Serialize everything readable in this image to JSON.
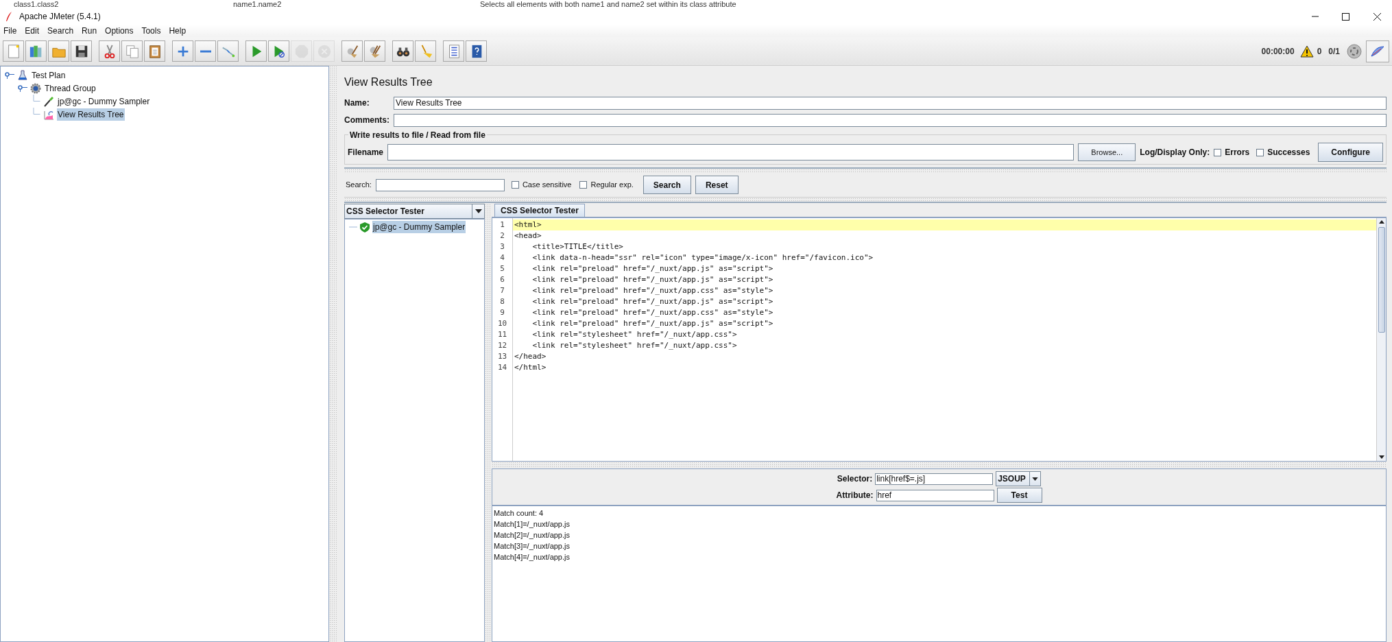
{
  "background_strip": [
    "class1.class2",
    "name1.name2",
    "Selects all elements with both name1 and name2 set within its class attribute"
  ],
  "window": {
    "title": "Apache JMeter (5.4.1)"
  },
  "menu": [
    "File",
    "Edit",
    "Search",
    "Run",
    "Options",
    "Tools",
    "Help"
  ],
  "toolbar": [
    [
      {
        "kind": "new",
        "disabled": false
      },
      {
        "kind": "templates",
        "disabled": false
      },
      {
        "kind": "open",
        "disabled": false
      },
      {
        "kind": "save",
        "disabled": false
      }
    ],
    [
      {
        "kind": "cut",
        "disabled": false
      },
      {
        "kind": "copy",
        "disabled": false
      },
      {
        "kind": "paste",
        "disabled": false
      }
    ],
    [
      {
        "kind": "add",
        "disabled": false
      },
      {
        "kind": "remove",
        "disabled": false
      },
      {
        "kind": "toggle",
        "disabled": false
      }
    ],
    [
      {
        "kind": "start",
        "disabled": false
      },
      {
        "kind": "start_no_timers",
        "disabled": false
      },
      {
        "kind": "stop",
        "disabled": true
      },
      {
        "kind": "shutdown",
        "disabled": true
      }
    ],
    [
      {
        "kind": "clear",
        "disabled": false
      },
      {
        "kind": "clear_all",
        "disabled": false
      }
    ],
    [
      {
        "kind": "search",
        "disabled": false
      },
      {
        "kind": "reset_search",
        "disabled": false
      }
    ],
    [
      {
        "kind": "functions",
        "disabled": false
      },
      {
        "kind": "help",
        "disabled": false
      }
    ]
  ],
  "status": {
    "elapsed": "00:00:00",
    "warnings": "0",
    "threads": "0/1"
  },
  "tree": [
    {
      "label": "Test Plan",
      "kind": "plan",
      "selected": false,
      "children": [
        {
          "label": "Thread Group",
          "kind": "group",
          "selected": false,
          "children": [
            {
              "label": "jp@gc - Dummy Sampler",
              "kind": "sampler",
              "selected": false
            },
            {
              "label": "View Results Tree",
              "kind": "listener",
              "selected": true
            }
          ]
        }
      ]
    }
  ],
  "panel": {
    "title": "View Results Tree",
    "name_label": "Name:",
    "name_value": "View Results Tree",
    "comments_label": "Comments:"
  },
  "file_group": {
    "legend": "Write results to file / Read from file",
    "filename_label": "Filename",
    "browse_button": "Browse...",
    "log_display_label": "Log/Display Only:",
    "checkboxes": [
      {
        "label": "Errors",
        "checked": false
      },
      {
        "label": "Successes",
        "checked": false
      }
    ],
    "configure_button": "Configure"
  },
  "search": {
    "label": "Search:",
    "options": [
      {
        "label": "Case sensitive",
        "checked": false
      },
      {
        "label": "Regular exp.",
        "checked": false
      }
    ],
    "search_button": "Search",
    "reset_button": "Reset"
  },
  "renderer": "CSS Selector Tester",
  "results": [
    {
      "label": "jp@gc - Dummy Sampler",
      "success": true,
      "selected": true
    }
  ],
  "tabs": [
    {
      "label": "CSS Selector Tester",
      "selected": true
    }
  ],
  "code": [
    {
      "number": "1",
      "text": "<html>",
      "highlighted": true
    },
    {
      "number": "2",
      "text": "<head>",
      "highlighted": false
    },
    {
      "number": "3",
      "text": "    <title>TITLE</title>",
      "highlighted": false
    },
    {
      "number": "4",
      "text": "    <link data-n-head=\"ssr\" rel=\"icon\" type=\"image/x-icon\" href=\"/favicon.ico\">",
      "highlighted": false
    },
    {
      "number": "5",
      "text": "    <link rel=\"preload\" href=\"/_nuxt/app.js\" as=\"script\">",
      "highlighted": false
    },
    {
      "number": "6",
      "text": "    <link rel=\"preload\" href=\"/_nuxt/app.js\" as=\"script\">",
      "highlighted": false
    },
    {
      "number": "7",
      "text": "    <link rel=\"preload\" href=\"/_nuxt/app.css\" as=\"style\">",
      "highlighted": false
    },
    {
      "number": "8",
      "text": "    <link rel=\"preload\" href=\"/_nuxt/app.js\" as=\"script\">",
      "highlighted": false
    },
    {
      "number": "9",
      "text": "    <link rel=\"preload\" href=\"/_nuxt/app.css\" as=\"style\">",
      "highlighted": false
    },
    {
      "number": "10",
      "text": "    <link rel=\"preload\" href=\"/_nuxt/app.js\" as=\"script\">",
      "highlighted": false
    },
    {
      "number": "11",
      "text": "    <link rel=\"stylesheet\" href=\"/_nuxt/app.css\">",
      "highlighted": false
    },
    {
      "number": "12",
      "text": "    <link rel=\"stylesheet\" href=\"/_nuxt/app.css\">",
      "highlighted": false
    },
    {
      "number": "13",
      "text": "</head>",
      "highlighted": false
    },
    {
      "number": "14",
      "text": "</html>",
      "highlighted": false
    }
  ],
  "tester": {
    "selector_label": "Selector:",
    "selector_value": "link[href$=.js]",
    "engine": "JSOUP",
    "attribute_label": "Attribute:",
    "attribute_value": "href",
    "test_button": "Test"
  },
  "result_lines": [
    "Match count: 4",
    "Match[1]=/_nuxt/app.js",
    "Match[2]=/_nuxt/app.js",
    "Match[3]=/_nuxt/app.js",
    "Match[4]=/_nuxt/app.js"
  ]
}
